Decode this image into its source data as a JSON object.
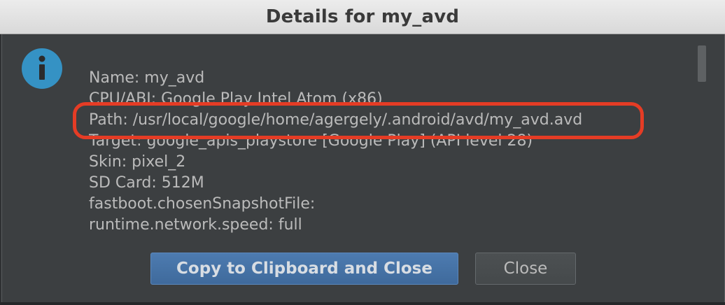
{
  "dialog": {
    "title": "Details for my_avd",
    "icon": "info-icon"
  },
  "details": [
    "Name: my_avd",
    "CPU/ABI: Google Play Intel Atom (x86)",
    "Path: /usr/local/google/home/agergely/.android/avd/my_avd.avd",
    "Target: google_apis_playstore [Google Play] (API level 28)",
    "Skin: pixel_2",
    "SD Card: 512M",
    "fastboot.chosenSnapshotFile:",
    "runtime.network.speed: full"
  ],
  "buttons": {
    "copy_close": "Copy to Clipboard and Close",
    "close": "Close"
  },
  "colors": {
    "highlight": "#e53c25",
    "primary_button": "#4670a3",
    "info_icon": "#3592c4"
  }
}
